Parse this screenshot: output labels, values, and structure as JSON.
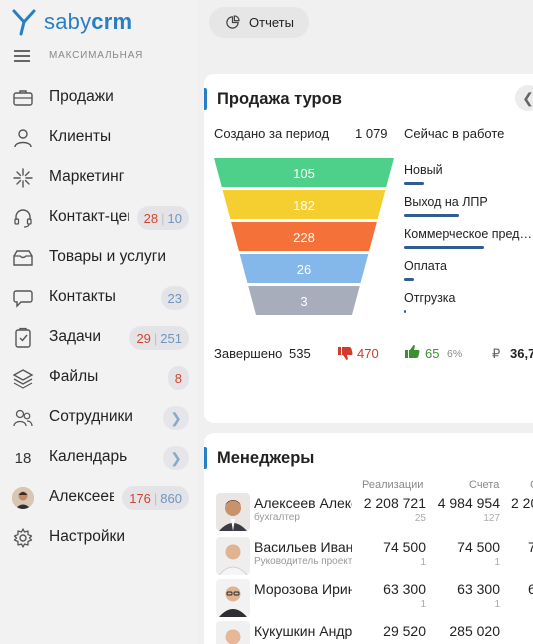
{
  "app": {
    "logo_text_light": "saby",
    "logo_text_bold": "crm",
    "plan": "МАКСИМАЛЬНАЯ"
  },
  "sidebar": {
    "items": [
      {
        "label": "Продажи",
        "icon": "briefcase-icon"
      },
      {
        "label": "Клиенты",
        "icon": "clients-icon"
      },
      {
        "label": "Маркетинг",
        "icon": "sparkle-icon"
      },
      {
        "label": "Контакт-центр",
        "icon": "headset-icon",
        "badge_red": "28",
        "badge_blue": "10"
      },
      {
        "label": "Товары и услуги",
        "icon": "box-icon"
      },
      {
        "label": "Контакты",
        "icon": "chat-icon",
        "badge_blue": "23"
      },
      {
        "label": "Задачи",
        "icon": "clipboard-icon",
        "badge_red": "29",
        "badge_blue": "251"
      },
      {
        "label": "Файлы",
        "icon": "stack-icon",
        "badge_red": "8"
      },
      {
        "label": "Сотрудники",
        "icon": "people-icon",
        "chevron": "❯"
      },
      {
        "label": "Календарь",
        "icon": "calendar-icon",
        "day": "18",
        "chevron": "❯"
      },
      {
        "label": "Алексеев Алексей",
        "icon": "user-avatar",
        "badge_red": "176",
        "badge_blue": "860"
      },
      {
        "label": "Настройки",
        "icon": "gear-icon"
      }
    ]
  },
  "toolbar": {
    "reports_label": "Отчеты"
  },
  "sales": {
    "title": "Продажа туров",
    "created_label": "Создано за период",
    "created_value": "1 079",
    "now_label": "Сейчас в работе",
    "funnel": [
      {
        "value": "105",
        "color": "#4fd08a"
      },
      {
        "value": "182",
        "color": "#f5cf2f"
      },
      {
        "value": "228",
        "color": "#f5713a"
      },
      {
        "value": "26",
        "color": "#84b7ea"
      },
      {
        "value": "3",
        "color": "#a8adbb"
      }
    ],
    "stages": [
      {
        "label": "Новый",
        "fill": 0.2
      },
      {
        "label": "Выход на ЛПР",
        "fill": 0.55
      },
      {
        "label": "Коммерческое предложение",
        "fill": 0.8
      },
      {
        "label": "Оплата",
        "fill": 0.1
      },
      {
        "label": "Отгрузка",
        "fill": 0.01
      }
    ],
    "done_label": "Завершено",
    "done_value": "535",
    "lost_value": "470",
    "won_value": "65",
    "won_pct": "6%",
    "currency": "₽",
    "sum": "36,7"
  },
  "managers": {
    "title": "Менеджеры",
    "col_sales": "Реализации",
    "col_invoices": "Счета",
    "col_third": "С",
    "rows": [
      {
        "name": "Алексеев Алексей",
        "role": "бухгалтер",
        "sales": "2 208 721",
        "sales_sub": "25",
        "invoices": "4 984 954",
        "invoices_sub": "127",
        "third": "2 20"
      },
      {
        "name": "Васильев Иван",
        "role": "Руководитель проекта",
        "sales": "74 500",
        "sales_sub": "1",
        "invoices": "74 500",
        "invoices_sub": "1",
        "third": "7"
      },
      {
        "name": "Морозова Ирина",
        "role": "",
        "sales": "63 300",
        "sales_sub": "1",
        "invoices": "63 300",
        "invoices_sub": "1",
        "third": "6"
      },
      {
        "name": "Кукушкин Андрей",
        "role": "",
        "sales": "29 520",
        "sales_sub": "",
        "invoices": "285 020",
        "invoices_sub": "",
        "third": ""
      }
    ]
  }
}
